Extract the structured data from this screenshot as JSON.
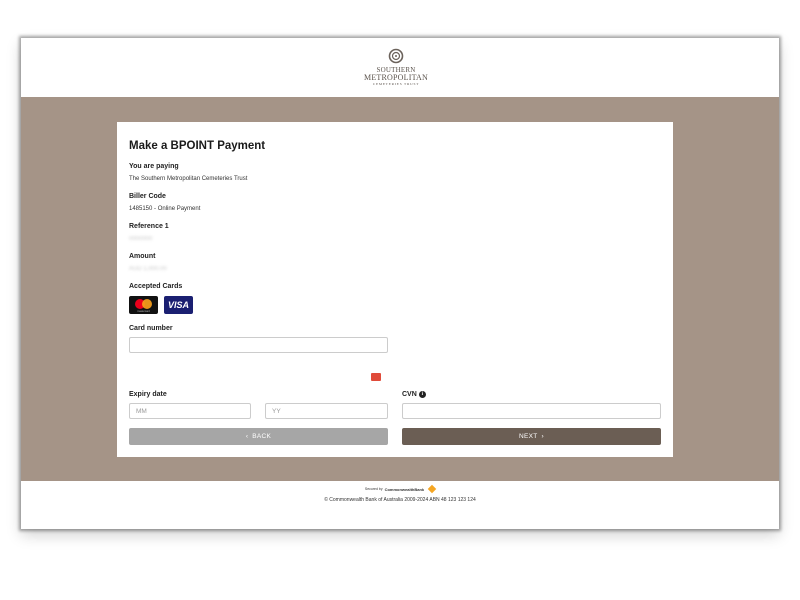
{
  "header": {
    "logo_line1": "SOUTHERN",
    "logo_line2": "METROPOLITAN",
    "logo_line3": "CEMETERIES TRUST",
    "logo_icon": "ring-emblem-icon"
  },
  "colors": {
    "band_background": "#a59487",
    "next_button": "#6b5e54",
    "back_button": "#a6a6a6"
  },
  "form": {
    "title": "Make a BPOINT Payment",
    "paying_label": "You are paying",
    "paying_value": "The Southern Metropolitan Cemeteries Trust",
    "biller_label": "Biller Code",
    "biller_value": "1485150 - Online Payment",
    "reference_label": "Reference 1",
    "reference_value": "0000000",
    "amount_label": "Amount",
    "amount_value": "AUD 1,000.00",
    "accepted_label": "Accepted Cards",
    "accepted_cards": [
      {
        "name": "Mastercard",
        "icon": "mastercard-icon",
        "caption": "mastercard"
      },
      {
        "name": "VISA",
        "icon": "visa-icon"
      }
    ],
    "card_number_label": "Card number",
    "card_number_value": "",
    "card_number_icon": "credit-card-icon",
    "expiry_label": "Expiry date",
    "expiry_month_placeholder": "MM",
    "expiry_year_placeholder": "YY",
    "cvn_label": "CVN",
    "cvn_info_icon": "info-icon",
    "back_label": "BACK",
    "next_label": "NEXT"
  },
  "footer": {
    "secured_prefix": "Secured by",
    "secured_brand": "CommonwealthBank",
    "copyright": "© Commonwealth Bank of Australia 2009-2024 ABN 48 123 123 124"
  }
}
